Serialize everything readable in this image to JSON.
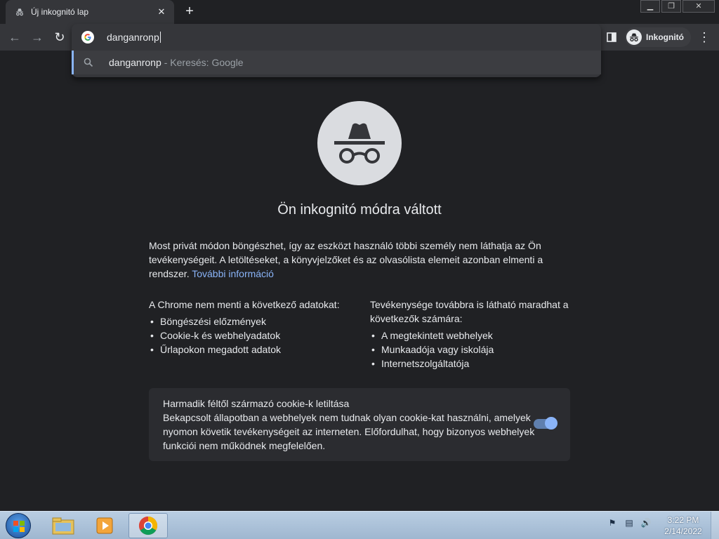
{
  "window": {
    "tab_title": "Új inkognitó lap",
    "tab_close": "✕",
    "new_tab": "+",
    "minimize": "▁",
    "restore": "❐",
    "close": "✕"
  },
  "toolbar": {
    "back": "←",
    "forward": "→",
    "reload": "↻",
    "profile_label": "Inkognitó",
    "menu": "⋮"
  },
  "omnibox": {
    "value": "danganronp",
    "suggestion_query": "danganronp",
    "suggestion_hint": "- Keresés: Google"
  },
  "page": {
    "heading": "Ön inkognitó módra váltott",
    "intro_text": "Most privát módon böngészhet, így az eszközt használó többi személy nem láthatja az Ön tevékenységeit. A letöltéseket, a könyvjelzőket és az olvasólista elemeit azonban elmenti a rendszer.",
    "intro_link": "További információ",
    "left_title": "A Chrome nem menti a következő adatokat:",
    "left_items": [
      "Böngészési előzmények",
      "Cookie-k és webhelyadatok",
      "Űrlapokon megadott adatok"
    ],
    "right_title": "Tevékenysége továbbra is látható maradhat a következők számára:",
    "right_items": [
      "A megtekintett webhelyek",
      "Munkaadója vagy iskolája",
      "Internetszolgáltatója"
    ],
    "cookie_title": "Harmadik féltől származó cookie-k letiltása",
    "cookie_desc": "Bekapcsolt állapotban a webhelyek nem tudnak olyan cookie-kat használni, amelyek nyomon követik tevékenységeit az interneten. Előfordulhat, hogy bizonyos webhelyek funkciói nem működnek megfelelően.",
    "cookie_toggle_on": true
  },
  "taskbar": {
    "time": "3:22 PM",
    "date": "2/14/2022",
    "apps": [
      "explorer-icon",
      "media-player-icon",
      "chrome-icon"
    ]
  },
  "colors": {
    "background": "#202124",
    "toolbar": "#35363a",
    "link": "#8ab4f8",
    "text": "#e8eaed"
  }
}
